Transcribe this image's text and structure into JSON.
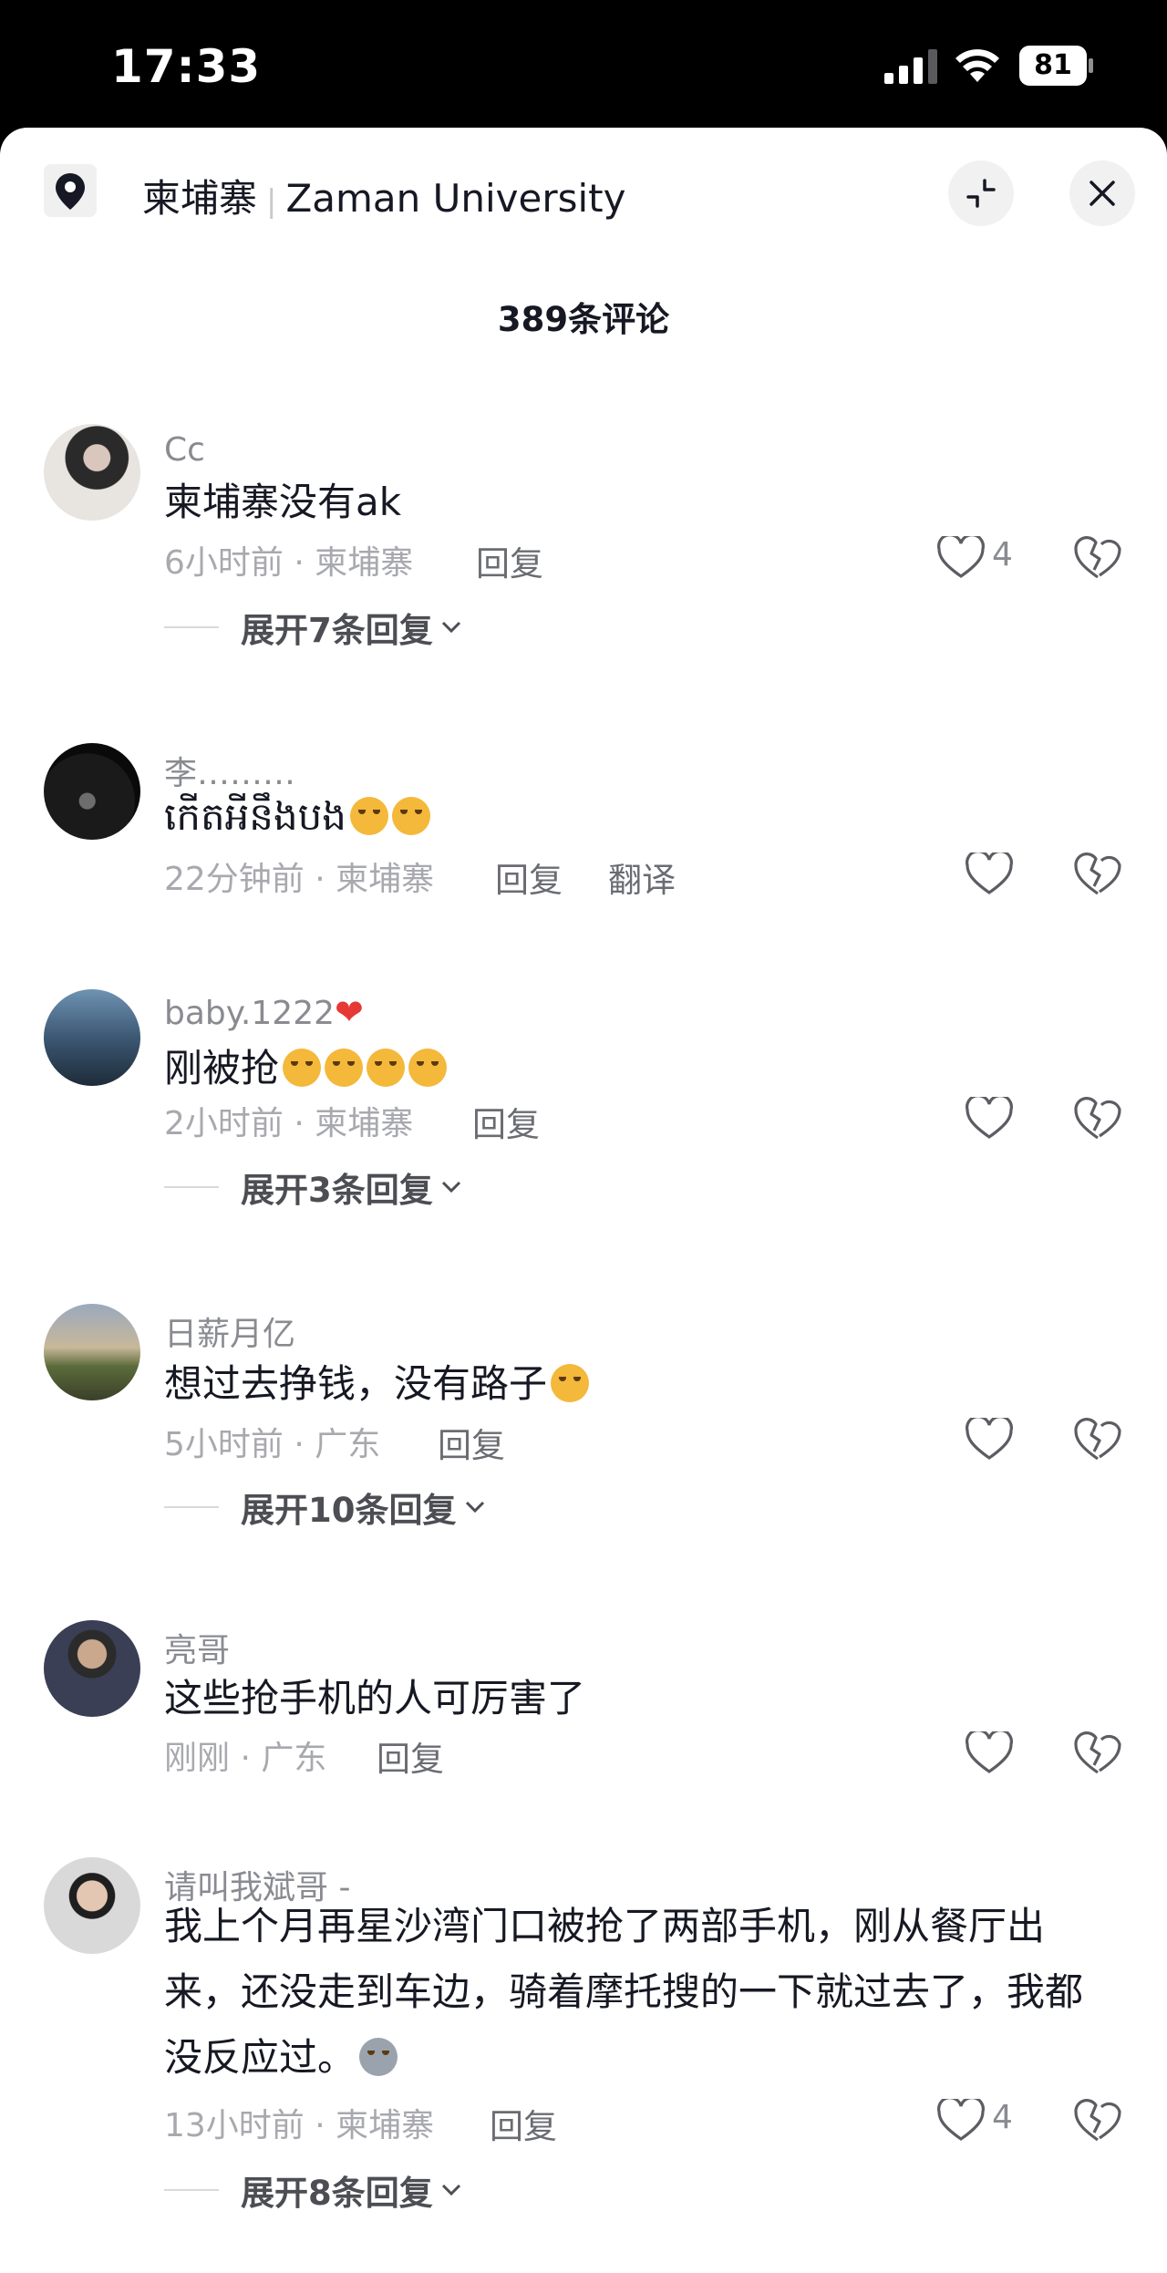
{
  "status": {
    "time": "17:33",
    "battery": "81"
  },
  "header": {
    "location_primary": "柬埔寨",
    "location_secondary": "Zaman University"
  },
  "comments_count": "389条评论",
  "comments": [
    {
      "name": "Cc",
      "text": "柬埔寨没有ak",
      "meta": "6小时前 · 柬埔寨",
      "reply": "回复",
      "likes": "4",
      "expand": "展开7条回复"
    },
    {
      "name": "李………",
      "text": "កើតអីនឹងបង",
      "meta": "22分钟前 · 柬埔寨",
      "reply": "回复",
      "translate": "翻译"
    },
    {
      "name": "baby.1222",
      "text": "刚被抢",
      "meta": "2小时前 · 柬埔寨",
      "reply": "回复",
      "expand": "展开3条回复"
    },
    {
      "name": "日薪月亿",
      "text": "想过去挣钱，没有路子",
      "meta": "5小时前 · 广东",
      "reply": "回复",
      "expand": "展开10条回复"
    },
    {
      "name": "亮哥",
      "text": "这些抢手机的人可厉害了",
      "meta": "刚刚 · 广东",
      "reply": "回复"
    },
    {
      "name": "请叫我斌哥 -",
      "text": "我上个月再星沙湾门口被抢了两部手机，刚从餐厅出来，还没走到车边，骑着摩托搜的一下就过去了，我都没反应过。",
      "meta": "13小时前 · 柬埔寨",
      "reply": "回复",
      "likes": "4",
      "expand": "展开8条回复"
    }
  ],
  "colors": {
    "text_primary": "#161823",
    "text_secondary": "#8a8b91",
    "heart_red": "#e53935"
  }
}
